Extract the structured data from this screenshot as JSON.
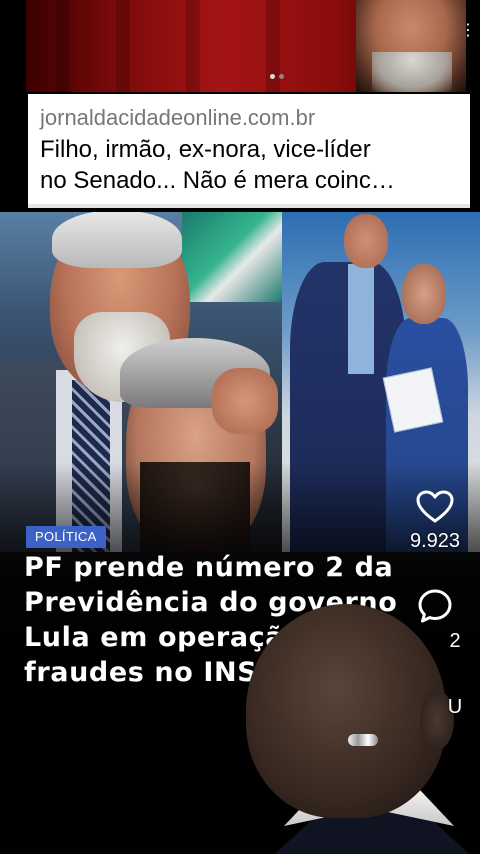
{
  "carousel": {
    "menu_glyph": "⋮",
    "dots": 2,
    "active_dot": 0
  },
  "link_card": {
    "domain": "jornaldacidadeonline.com.br",
    "title_line1": "Filho, irmão, ex-nora, vice-líder",
    "title_line2": "no Senado... Não é mera coinc…"
  },
  "post": {
    "category_tag": "POLÍTICA",
    "headline_lines": [
      "PF prende número 2 da",
      "Previdência do governo",
      "Lula em operação contra",
      "fraudes no INSS"
    ]
  },
  "actions": {
    "like": {
      "icon": "heart-icon",
      "count": "9.923"
    },
    "comment": {
      "icon": "comment-icon",
      "count": "2"
    },
    "share": {
      "icon": "share-icon",
      "count": "U"
    }
  }
}
